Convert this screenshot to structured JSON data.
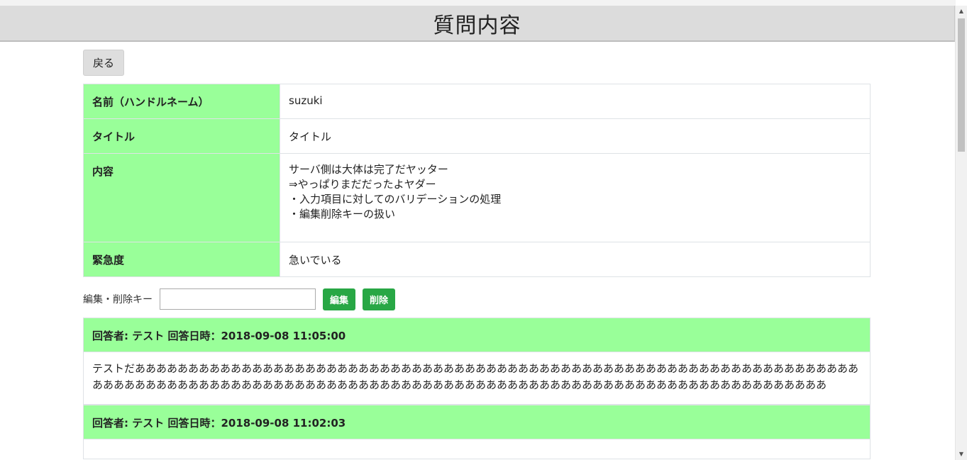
{
  "header": {
    "title": "質問内容"
  },
  "back_button": "戻る",
  "detail": {
    "name_label": "名前（ハンドルネーム）",
    "name_value": "suzuki",
    "title_label": "タイトル",
    "title_value": "タイトル",
    "content_label": "内容",
    "content_lines": [
      "サーバ側は大体は完了だヤッター",
      "⇒やっぱりまだだったよヤダー",
      "・入力項目に対してのバリデーションの処理",
      "・編集削除キーの扱い"
    ],
    "urgency_label": "緊急度",
    "urgency_value": "急いでいる"
  },
  "key_form": {
    "label": "編集・削除キー",
    "input_value": "",
    "edit_button": "編集",
    "delete_button": "削除"
  },
  "answers": [
    {
      "header": "回答者: テスト 回答日時：2018-09-08 11:05:00",
      "body": "テストだあああああああああああああああああああああああああああああああああああああああああああああああああああああああああああああああああああああああああああああああああああああああああああああああああああああああああああああああああああああああああああああああああああああああああ"
    },
    {
      "header": "回答者: テスト 回答日時：2018-09-08 11:02:03",
      "body": ""
    }
  ]
}
